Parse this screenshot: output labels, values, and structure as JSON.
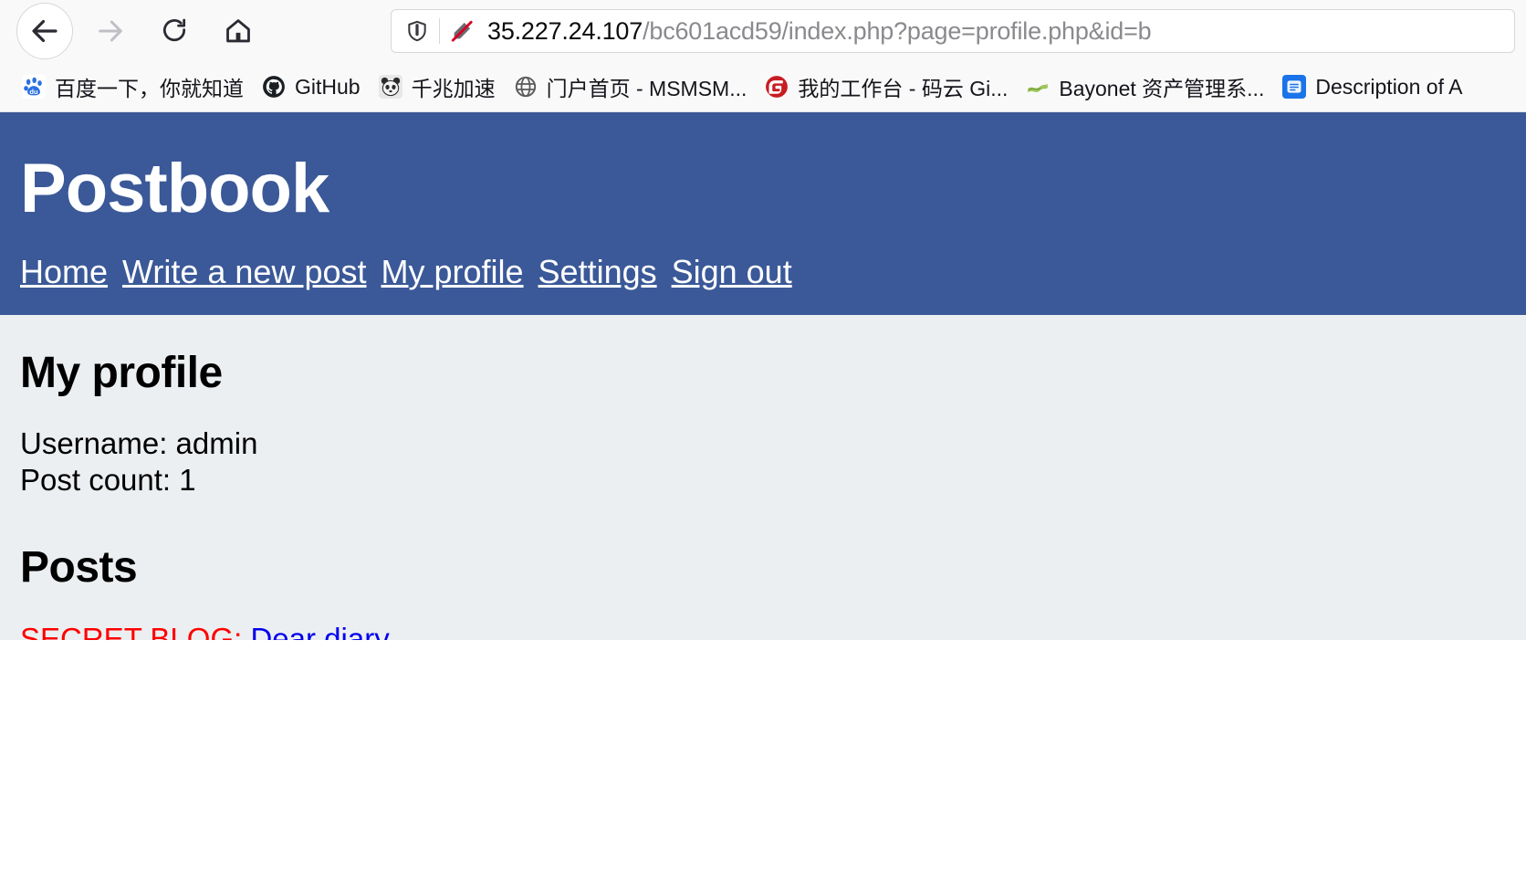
{
  "browser": {
    "nav": {
      "back_icon": "back-arrow-icon",
      "forward_icon": "forward-arrow-icon",
      "reload_icon": "reload-icon",
      "home_icon": "home-icon"
    },
    "urlbar": {
      "shield_icon": "shield-icon",
      "insecure_icon": "insecure-connection-icon",
      "host": "35.227.24.107",
      "path": "/bc601acd59/index.php?page=profile.php&id=b",
      "full_url": "35.227.24.107/bc601acd59/index.php?page=profile.php&id=b"
    },
    "bookmarks": [
      {
        "label": "百度一下，你就知道",
        "icon": "baidu-icon",
        "icon_glyph": "du",
        "icon_color": "#ffffff",
        "icon_text_color": "#2b6fe3"
      },
      {
        "label": "GitHub",
        "icon": "github-icon",
        "icon_glyph": "",
        "icon_color": "#24292e",
        "icon_text_color": "#ffffff"
      },
      {
        "label": "千兆加速",
        "icon": "panda-icon",
        "icon_glyph": "",
        "icon_color": "#d8d8d8",
        "icon_text_color": "#2b2b2b"
      },
      {
        "label": "门户首页 - MSMSM...",
        "icon": "globe-icon",
        "icon_glyph": "",
        "icon_color": "#ffffff",
        "icon_text_color": "#5b5b5b"
      },
      {
        "label": "我的工作台 - 码云 Gi...",
        "icon": "gitee-icon",
        "icon_glyph": "G",
        "icon_color": "#c71d23",
        "icon_text_color": "#ffffff"
      },
      {
        "label": "Bayonet 资产管理系...",
        "icon": "bayonet-flag-icon",
        "icon_glyph": "",
        "icon_color": "#ffffff",
        "icon_text_color": "#8fbf4d"
      },
      {
        "label": "Description of A",
        "icon": "description-app-icon",
        "icon_glyph": "",
        "icon_color": "#1a73e8",
        "icon_text_color": "#ffffff"
      }
    ]
  },
  "site": {
    "title": "Postbook",
    "nav_links": [
      {
        "label": "Home"
      },
      {
        "label": "Write a new post"
      },
      {
        "label": "My profile"
      },
      {
        "label": "Settings"
      },
      {
        "label": "Sign out"
      }
    ],
    "header_color": "#3b5998",
    "background_color": "#eceff1"
  },
  "profile": {
    "heading": "My profile",
    "username_line": "Username: admin",
    "post_count_line": "Post count: 1"
  },
  "posts": {
    "heading": "Posts",
    "items": [
      {
        "prefix": "SECRET BLOG: ",
        "link_text": "Dear diary...",
        "prefix_color": "#ff0000",
        "link_color": "#0000ee"
      }
    ]
  }
}
